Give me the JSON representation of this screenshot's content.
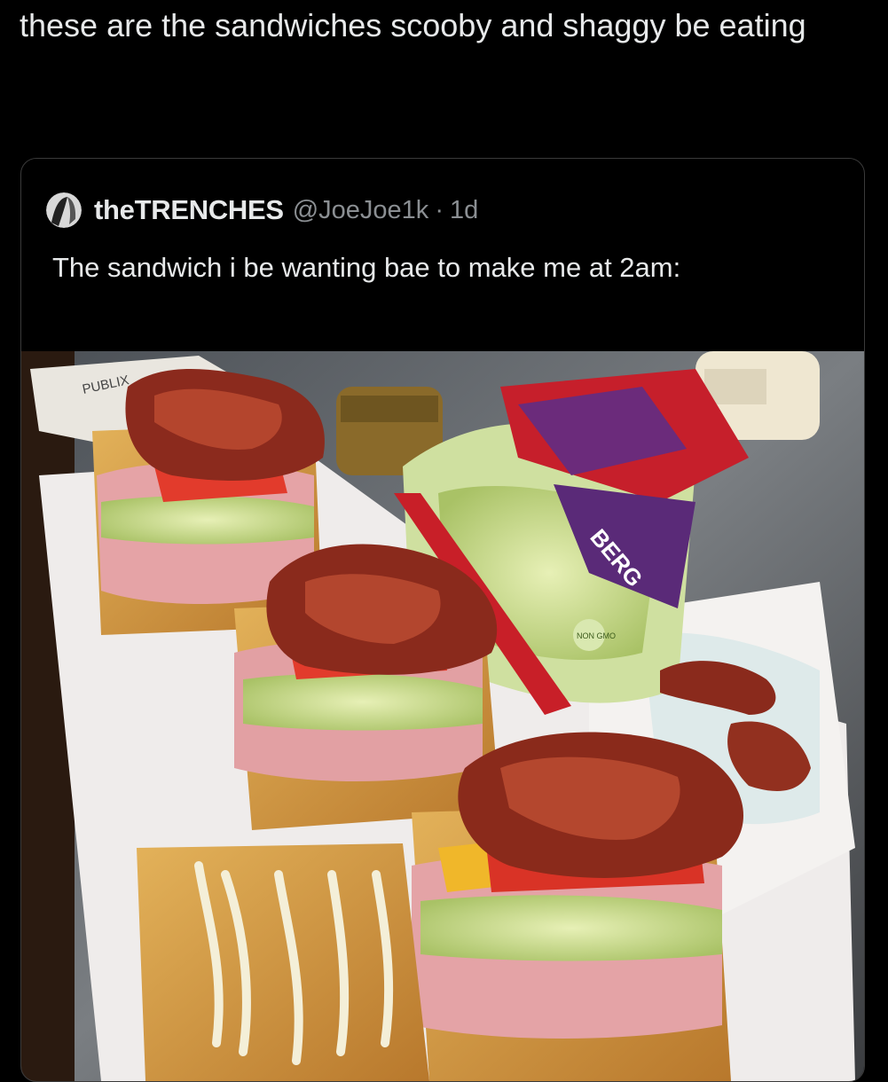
{
  "caption": "these are the sandwiches scooby and shaggy be eating",
  "quoted_tweet": {
    "author_name": "theTRENCHES",
    "author_handle": "@JoeJoe1k",
    "separator": "·",
    "age": "1d",
    "text": "The sandwich i be wanting bae to make me at 2am:"
  },
  "photo": {
    "label_text": "PUBLIX",
    "bag_brand_text": "BERG",
    "bag_badge_text": "NON GMO"
  }
}
